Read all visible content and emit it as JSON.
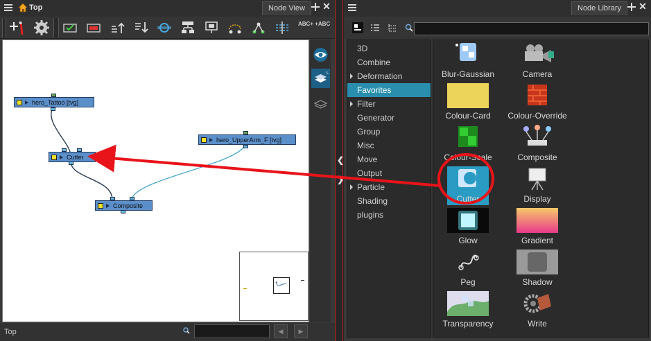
{
  "left_panel": {
    "breadcrumb": "Top",
    "tab_label": "Node View",
    "toolbar": {
      "abc_text": "ABC+ +ABC"
    },
    "nodes": {
      "tattoo": "hero_Tattoo [tvg]",
      "upperarm": "hero_UpperArm_F [tvg]",
      "cutter": "Cutter",
      "composite": "Composite"
    },
    "status": "Top"
  },
  "right_panel": {
    "tab_label": "Node Library",
    "categories": [
      {
        "label": "3D",
        "expandable": false
      },
      {
        "label": "Combine",
        "expandable": false
      },
      {
        "label": "Deformation",
        "expandable": true
      },
      {
        "label": "Favorites",
        "expandable": false,
        "selected": true
      },
      {
        "label": "Filter",
        "expandable": true
      },
      {
        "label": "Generator",
        "expandable": false
      },
      {
        "label": "Group",
        "expandable": false
      },
      {
        "label": "Misc",
        "expandable": false
      },
      {
        "label": "Move",
        "expandable": false
      },
      {
        "label": "Output",
        "expandable": false
      },
      {
        "label": "Particle",
        "expandable": true
      },
      {
        "label": "Shading",
        "expandable": false
      },
      {
        "label": "plugins",
        "expandable": false
      }
    ],
    "nodes": [
      {
        "label": "Blur-Gaussian",
        "icon": "blur-gaussian-icon"
      },
      {
        "label": "Camera",
        "icon": "camera-icon"
      },
      {
        "label": "Colour-Card",
        "icon": "colour-card-icon"
      },
      {
        "label": "Colour-Override",
        "icon": "colour-override-icon"
      },
      {
        "label": "Colour-Scale",
        "icon": "colour-scale-icon"
      },
      {
        "label": "Composite",
        "icon": "composite-icon"
      },
      {
        "label": "Cutter",
        "icon": "cutter-icon",
        "selected": true
      },
      {
        "label": "Display",
        "icon": "display-icon"
      },
      {
        "label": "Glow",
        "icon": "glow-icon"
      },
      {
        "label": "Gradient",
        "icon": "gradient-icon"
      },
      {
        "label": "Peg",
        "icon": "peg-icon"
      },
      {
        "label": "Shadow",
        "icon": "shadow-icon"
      },
      {
        "label": "Transparency",
        "icon": "transparency-icon"
      },
      {
        "label": "Write",
        "icon": "write-icon"
      }
    ]
  },
  "colors": {
    "node_blue": "#5b8fc9",
    "selection": "#2a9bc2",
    "annotation_red": "#e8141a"
  }
}
